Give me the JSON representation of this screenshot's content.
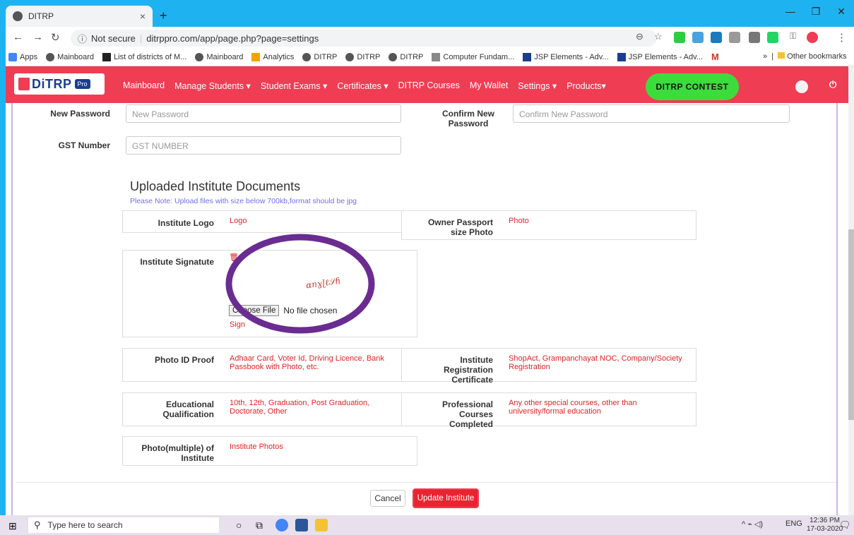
{
  "browser": {
    "tab_title": "DITRP",
    "new_tab": "+",
    "url_secure": "Not secure",
    "url": "ditrppro.com/app/page.php?page=settings",
    "bookmarks": [
      "Apps",
      "Mainboard",
      "List of districts of M...",
      "Mainboard",
      "Analytics",
      "DITRP",
      "DITRP",
      "DITRP",
      "Computer Fundam...",
      "JSP Elements - Adv...",
      "JSP Elements - Adv..."
    ],
    "bookmarks_more": "»",
    "other_bookmarks": "Other bookmarks"
  },
  "site": {
    "logo_text": "DiTRP",
    "logo_badge": "Pro",
    "menu": [
      "Mainboard",
      "Manage Students ▾",
      "Student Exams ▾",
      "Certificates ▾",
      "DITRP Courses",
      "My Wallet",
      "Settings ▾",
      "Products▾"
    ],
    "contest": "DITRP CONTEST"
  },
  "form": {
    "new_password_label": "New Password",
    "new_password_placeholder": "New Password",
    "confirm_password_label": "Confirm New Password",
    "confirm_password_placeholder": "Confirm New Password",
    "gst_label": "GST Number",
    "gst_placeholder": "GST NUMBER"
  },
  "documents": {
    "heading": "Uploaded Institute Documents",
    "note": "Please Note: Upload files with size below 700kb,format should be jpg",
    "logo_label": "Institute Logo",
    "logo_value": "Logo",
    "passport_label": "Owner Passport size Photo",
    "passport_value": "Photo",
    "signature_label": "Institute Signatute",
    "signature_file_button": "Choose File",
    "signature_file_status": "No file chosen",
    "signature_value": "Sign",
    "photo_id_label": "Photo ID Proof",
    "photo_id_value": "Adhaar Card, Voter Id, Driving Licence, Bank Passbook with Photo, etc.",
    "registration_label": "Institute Registration Certificate",
    "registration_value": "ShopAct, Grampanchayat NOC, Company/Society Registration",
    "education_label": "Educational Qualification",
    "education_value": "10th, 12th, Graduation, Post Graduation, Doctorate, Other",
    "professional_label": "Professional Courses Completed",
    "professional_value": "Any other special courses, other than university/formal education",
    "photos_label": "Photo(multiple) of Institute",
    "photos_value": "Institute Photos"
  },
  "actions": {
    "cancel": "Cancel",
    "update": "Update Institute"
  },
  "taskbar": {
    "search_placeholder": "Type here to search",
    "lang": "ENG",
    "time": "12:36 PM",
    "date": "17-03-2020"
  },
  "colors": {
    "brand": "#ef3d54",
    "contest": "#3ddc3d",
    "annotation": "#6a2c91"
  }
}
